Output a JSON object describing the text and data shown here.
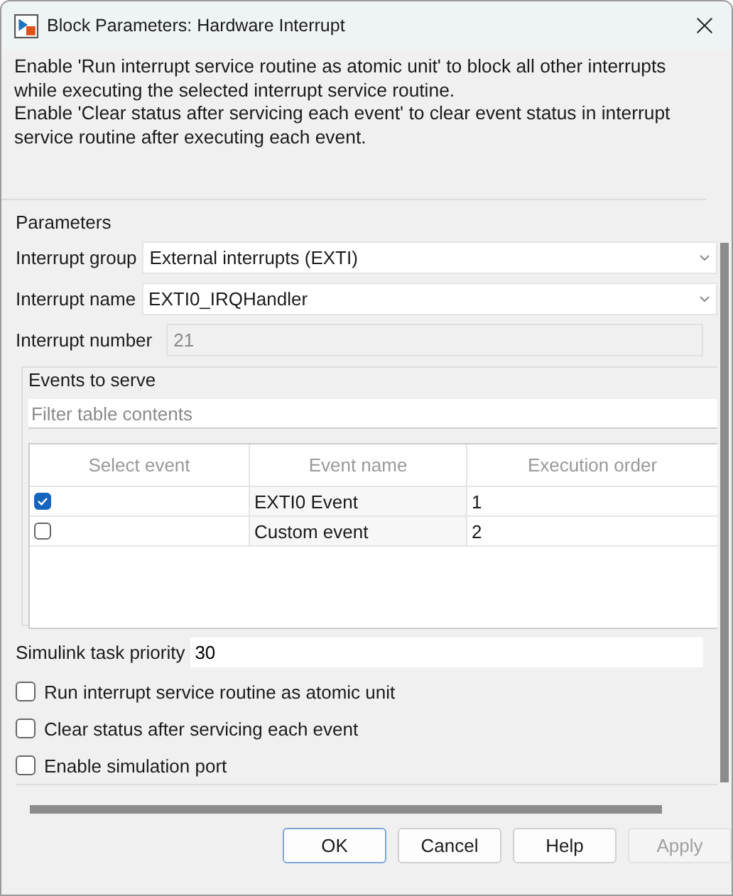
{
  "window": {
    "title": "Block Parameters: Hardware Interrupt"
  },
  "description": [
    "Enable 'Run interrupt service routine as atomic unit' to block all other interrupts while executing the selected interrupt service routine.",
    "Enable 'Clear status after servicing each event' to clear event status in interrupt service routine after executing each event."
  ],
  "parameters": {
    "title": "Parameters",
    "fields": [
      {
        "label": "Interrupt group",
        "value": "External interrupts (EXTI)",
        "kind": "dropdown"
      },
      {
        "label": "Interrupt name",
        "value": "EXTI0_IRQHandler",
        "kind": "dropdown"
      },
      {
        "label": "Interrupt number",
        "value": "21",
        "kind": "readonly"
      }
    ],
    "events": {
      "title": "Events to serve",
      "filter": {
        "placeholder": "Filter table contents"
      },
      "columns": [
        "Select event",
        "Event name",
        "Execution order"
      ],
      "rows": [
        {
          "checked": true,
          "name": "EXTI0 Event",
          "order": "1"
        },
        {
          "checked": false,
          "name": "Custom event",
          "order": "2"
        }
      ]
    },
    "priority": {
      "label": "Simulink task priority",
      "value": "30"
    },
    "options": [
      {
        "label": "Run interrupt service routine as atomic unit",
        "checked": false
      },
      {
        "label": "Clear status after servicing each event",
        "checked": false
      },
      {
        "label": "Enable simulation port",
        "checked": false
      }
    ]
  },
  "buttons": [
    {
      "label": "OK",
      "disabled": false,
      "default": true
    },
    {
      "label": "Cancel",
      "disabled": false,
      "default": false
    },
    {
      "label": "Help",
      "disabled": false,
      "default": false
    },
    {
      "label": "Apply",
      "disabled": true,
      "default": false
    }
  ]
}
